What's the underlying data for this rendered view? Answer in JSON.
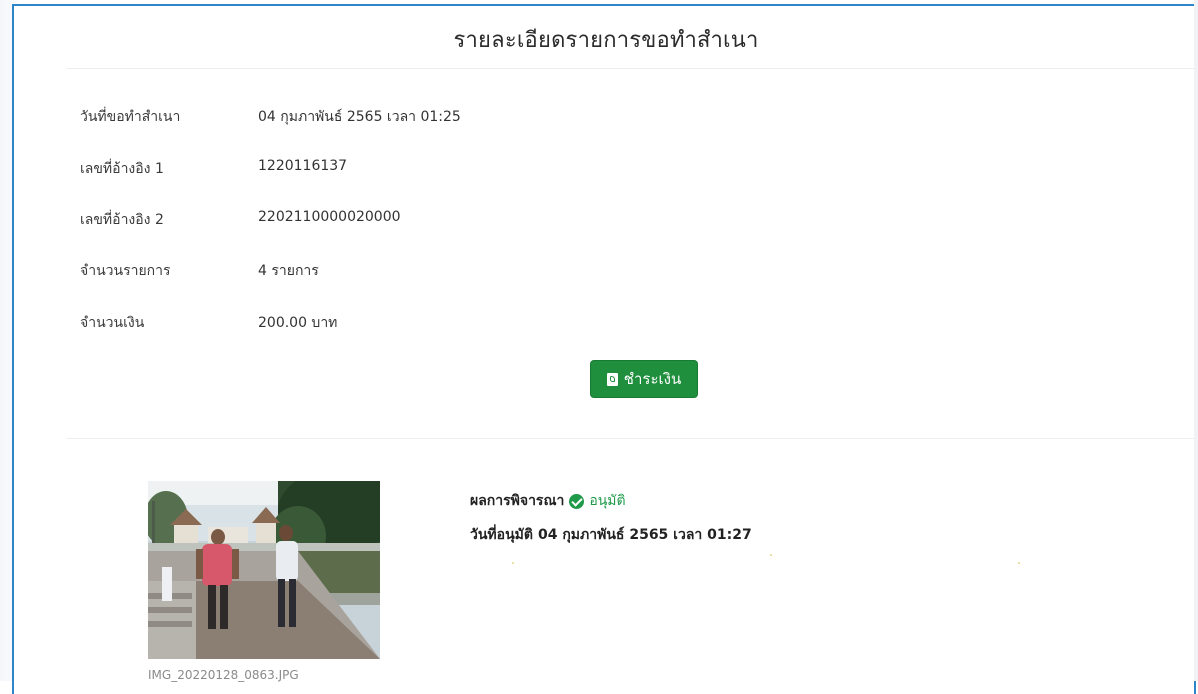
{
  "page": {
    "title": "รายละเอียดรายการขอทำสำเนา"
  },
  "details": [
    {
      "label": "วันที่ขอทำสำเนา",
      "value": "04 กุมภาพันธ์ 2565 เวลา 01:25"
    },
    {
      "label": "เลขที่อ้างอิง 1",
      "value": "1220116137"
    },
    {
      "label": "เลขที่อ้างอิง 2",
      "value": "2202110000020000"
    },
    {
      "label": "จำนวนรายการ",
      "value": "4 รายการ"
    },
    {
      "label": "จำนวนเงิน",
      "value": "200.00 บาท"
    }
  ],
  "actions": {
    "pay_label": "ชำระเงิน",
    "pay_icon": "file-pdf-icon",
    "button_color": "#1f8e3d"
  },
  "result": {
    "label": "ผลการพิจารณา",
    "status": "อนุมัติ",
    "status_icon": "check-circle-icon",
    "status_color": "#1f9a4a",
    "approval_date_label": "วันที่อนุมัติ",
    "approval_date": "04 กุมภาพันธ์ 2565 เวลา 01:27"
  },
  "attachment": {
    "filename": "IMG_20220128_0863.JPG"
  }
}
